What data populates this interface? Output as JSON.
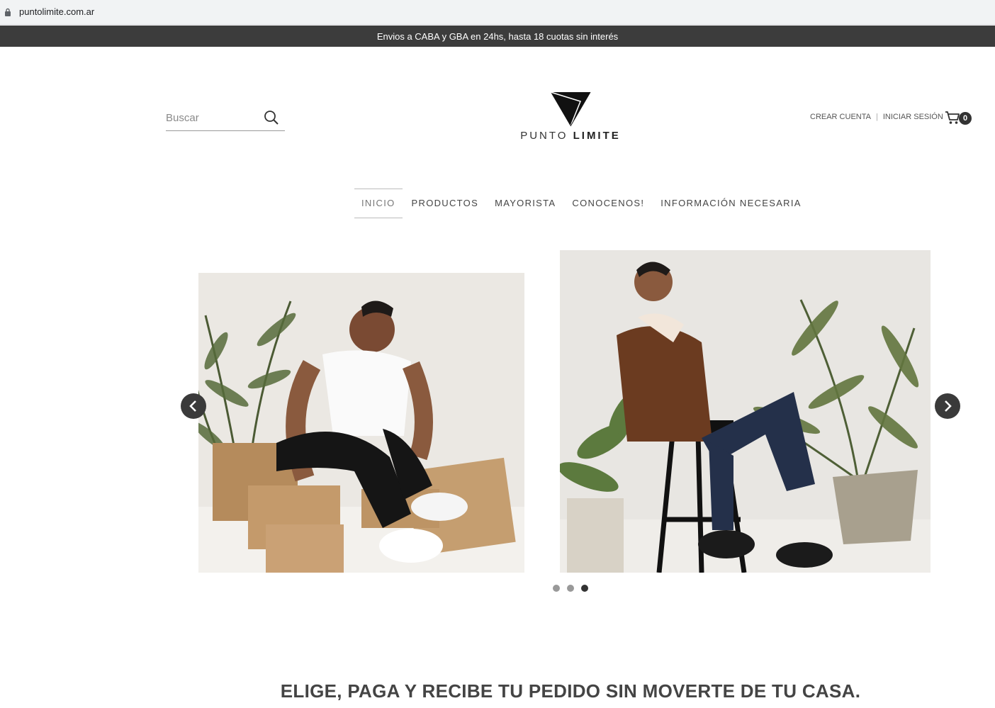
{
  "browser": {
    "url": "puntolimite.com.ar"
  },
  "promo": {
    "text": "Envios a CABA y GBA en 24hs, hasta 18 cuotas sin interés"
  },
  "search": {
    "placeholder": "Buscar"
  },
  "logo": {
    "word_light": "PUNTO",
    "word_bold": "LIMITE"
  },
  "account": {
    "create_label": "CREAR CUENTA",
    "separator": "|",
    "login_label": "INICIAR SESIÓN"
  },
  "cart": {
    "count": "0"
  },
  "nav": {
    "items": [
      {
        "label": "INICIO",
        "active": true
      },
      {
        "label": "PRODUCTOS"
      },
      {
        "label": "MAYORISTA"
      },
      {
        "label": "CONOCENOS!"
      },
      {
        "label": "INFORMACIÓN NECESARIA"
      }
    ]
  },
  "slider": {
    "dots": 3,
    "active_dot": 3
  },
  "headline": {
    "text": "ELIGE, PAGA Y RECIBE TU PEDIDO SIN MOVERTE DE TU CASA."
  }
}
